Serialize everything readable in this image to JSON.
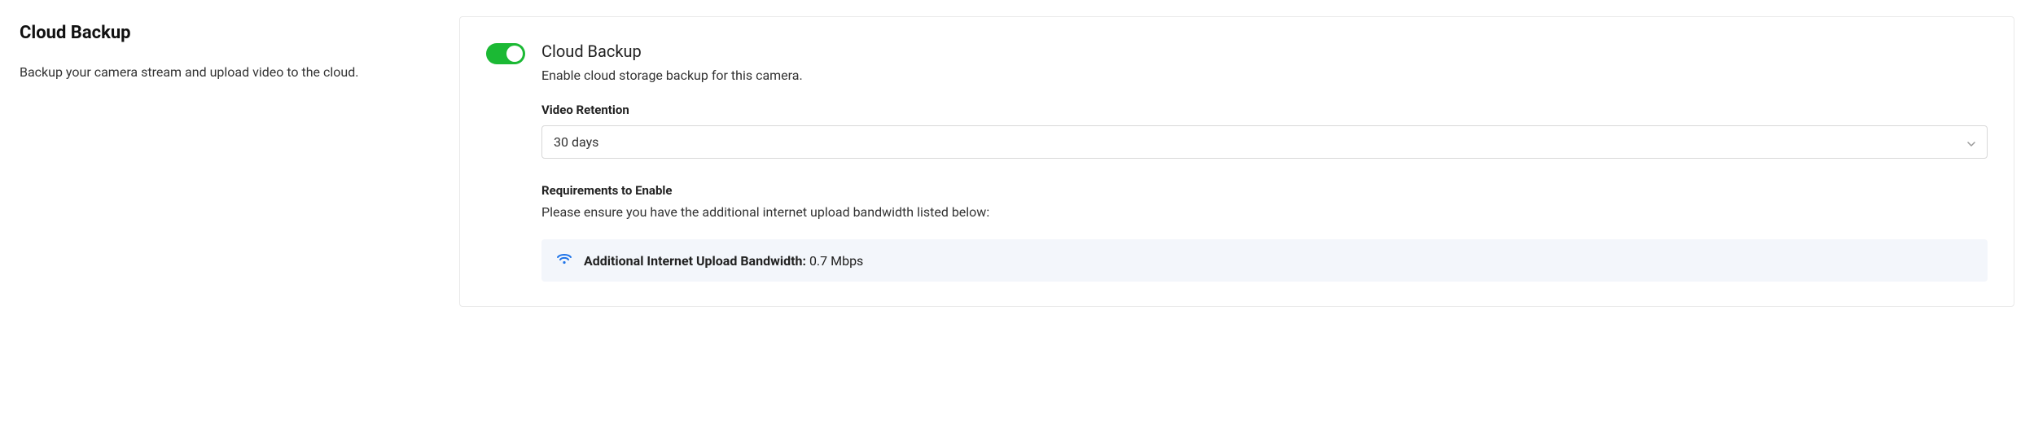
{
  "left": {
    "title": "Cloud Backup",
    "description": "Backup your camera stream and upload video to the cloud."
  },
  "right": {
    "toggle_title": "Cloud Backup",
    "toggle_description": "Enable cloud storage backup for this camera.",
    "toggle_on": true,
    "video_retention_label": "Video Retention",
    "video_retention_value": "30 days",
    "requirements_title": "Requirements to Enable",
    "requirements_description": "Please ensure you have the additional internet upload bandwidth listed below:",
    "bandwidth_label": "Additional Internet Upload Bandwidth:",
    "bandwidth_value": "0.7 Mbps"
  }
}
